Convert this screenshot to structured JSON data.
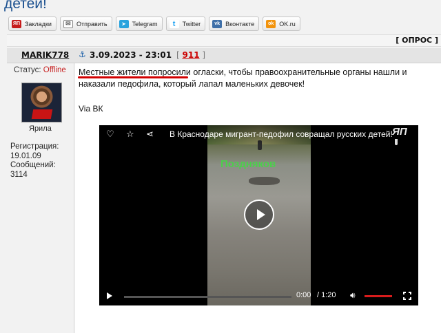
{
  "page": {
    "title": "детей!"
  },
  "share": [
    {
      "label": "Закладки",
      "icon": "yap-icon",
      "glyph": "ЯП"
    },
    {
      "label": "Отправить",
      "icon": "mail-icon",
      "glyph": "✉"
    },
    {
      "label": "Telegram",
      "icon": "telegram-icon",
      "glyph": "➤"
    },
    {
      "label": "Twitter",
      "icon": "twitter-icon",
      "glyph": "t"
    },
    {
      "label": "Вконтакте",
      "icon": "vk-icon",
      "glyph": "vk"
    },
    {
      "label": "OK.ru",
      "icon": "ok-icon",
      "glyph": "ok"
    }
  ],
  "poll": {
    "label": "[ ОПРОС ]"
  },
  "post": {
    "author": "MARIK778",
    "date": "3.09.2023 - 23:01",
    "number_open": "[ ",
    "number": "911",
    "number_close": " ]",
    "text_highlight": "Местные жители попросили",
    "text_rest": " огласки, чтобы правоохранительные органы нашли и наказали педофила, который лапал маленьких девочек!",
    "via": "Via ВК"
  },
  "user": {
    "status_label": "Статус: ",
    "status_value": "Offline",
    "avatar_name": "Ярила",
    "reg_info": "Регистрация:\n19.01.09\nСообщений:\n3114"
  },
  "video": {
    "title": "В Краснодаре мигрант-педофил совращал русских детей!",
    "watermark": "Поздняков",
    "logo": "ЯП",
    "time_current": "0:00",
    "time_total": "/ 1:20",
    "progress": 0,
    "volume": 1.0
  },
  "colors": {
    "title": "#1a4f8f",
    "accent_red": "#cc0000",
    "watermark_green": "#4bd04b"
  }
}
